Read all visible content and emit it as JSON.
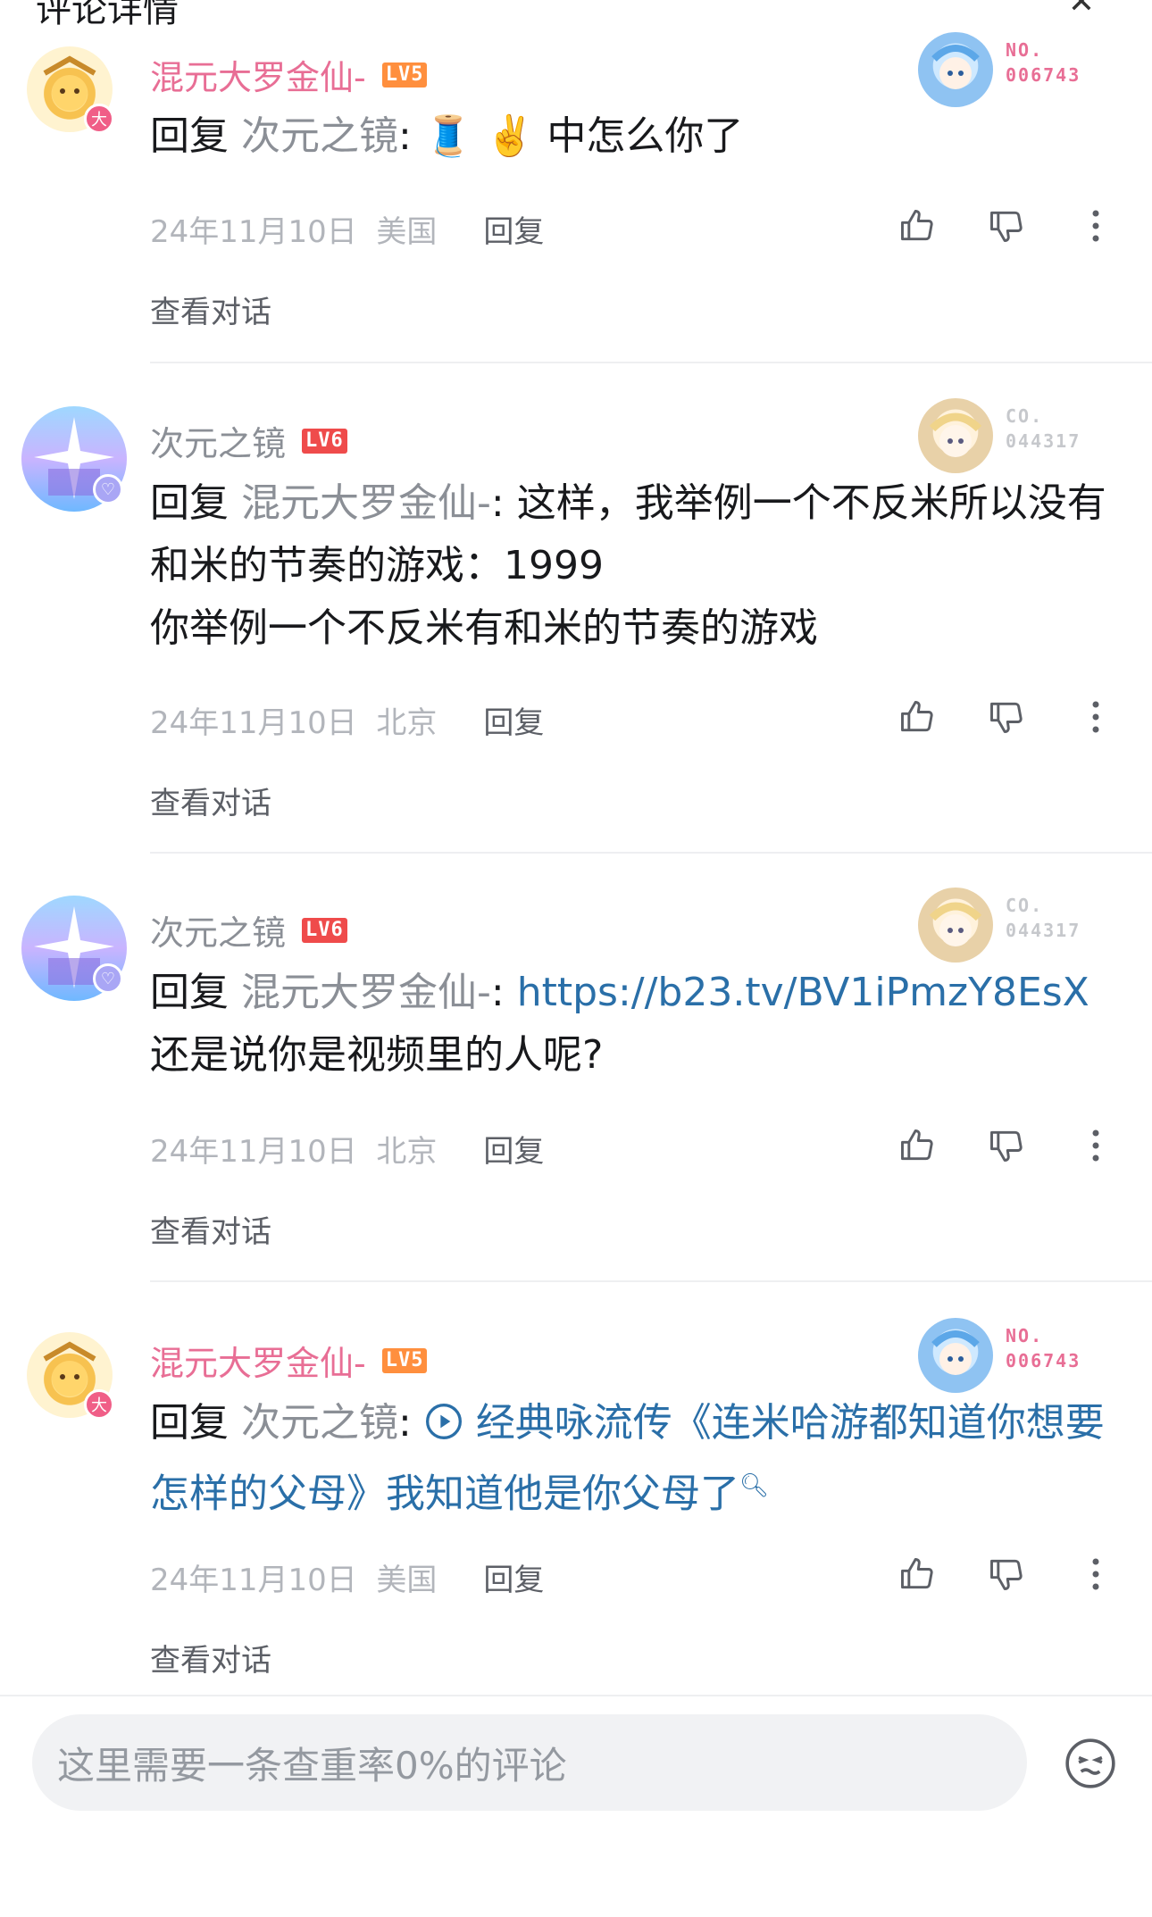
{
  "header": {
    "title_fragment": "评论详情"
  },
  "comments": [
    {
      "user": "混元大罗金仙-",
      "level": "LV5",
      "badge_text": "大",
      "card_no_label": "NO.",
      "card_no": "006743",
      "reply_prefix": "回复",
      "reply_target": "次元之镜",
      "text_after": ": 🧵 ✌️ 中怎么你了",
      "date": "24年11月10日",
      "location": "美国",
      "reply_label": "回复",
      "view_conversation": "查看对话"
    },
    {
      "user": "次元之镜",
      "level": "LV6",
      "card_no_label": "CO.",
      "card_no": "044317",
      "reply_prefix": "回复",
      "reply_target": "混元大罗金仙-",
      "text_after": ": 这样，我举例一个不反米所以没有和米的节奏的游戏：1999",
      "text_line2": "你举例一个不反米有和米的节奏的游戏",
      "date": "24年11月10日",
      "location": "北京",
      "reply_label": "回复",
      "view_conversation": "查看对话"
    },
    {
      "user": "次元之镜",
      "level": "LV6",
      "card_no_label": "CO.",
      "card_no": "044317",
      "reply_prefix": "回复",
      "reply_target": "混元大罗金仙-",
      "colon": ": ",
      "link": "https://b23.tv/BV1iPmzY8EsX",
      "text_after": " 还是说你是视频里的人呢?",
      "date": "24年11月10日",
      "location": "北京",
      "reply_label": "回复",
      "view_conversation": "查看对话"
    },
    {
      "user": "混元大罗金仙-",
      "level": "LV5",
      "badge_text": "大",
      "card_no_label": "NO.",
      "card_no": "006743",
      "reply_prefix": "回复",
      "reply_target": "次元之镜",
      "colon": ": ",
      "video_link": "经典咏流传《连米哈游都知道你想要怎样的父母》我知道他是你父母了",
      "date": "24年11月10日",
      "location": "美国",
      "reply_label": "回复",
      "view_conversation": "查看对话"
    }
  ],
  "input": {
    "placeholder": "这里需要一条查重率0%的评论"
  },
  "colors": {
    "vip_pink": "#e86e95",
    "grey_name": "#8b8f96",
    "link_blue": "#2a6fa8",
    "lv5": "#ff8f3e",
    "lv6": "#ef4b4b"
  },
  "icons": [
    "like-icon",
    "dislike-icon",
    "more-icon",
    "emoji-icon",
    "close-icon",
    "play-icon",
    "search-icon"
  ]
}
